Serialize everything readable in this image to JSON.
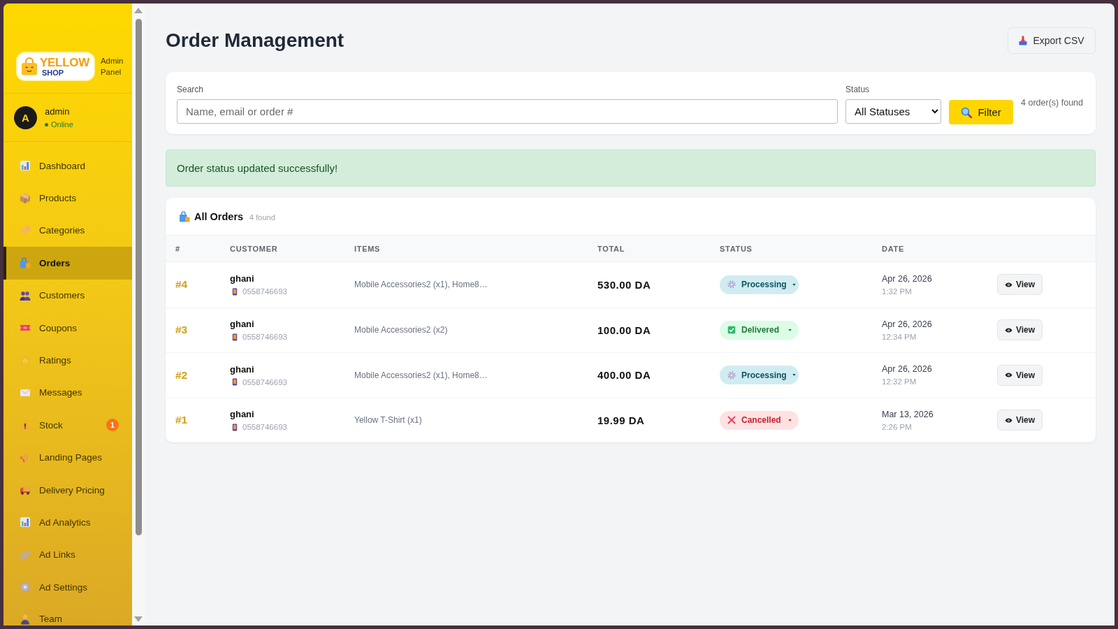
{
  "sidebar": {
    "logo": {
      "line_1": "YELLOW",
      "line_2": "SHOP"
    },
    "subtitle": "Admin Panel",
    "user": {
      "initial": "A",
      "name": "admin",
      "status": "Online"
    },
    "nav": [
      {
        "label": "Dashboard",
        "selected": false
      },
      {
        "label": "Products",
        "selected": false
      },
      {
        "label": "Categories",
        "selected": false
      },
      {
        "label": "Orders",
        "selected": true
      },
      {
        "label": "Customers",
        "selected": false
      },
      {
        "label": "Coupons",
        "selected": false
      },
      {
        "label": "Ratings",
        "selected": false
      },
      {
        "label": "Messages",
        "selected": false
      },
      {
        "label": "Stock",
        "selected": false,
        "badge": "1"
      },
      {
        "label": "Landing Pages",
        "selected": false
      },
      {
        "label": "Delivery Pricing",
        "selected": false
      },
      {
        "label": "Ad Analytics",
        "selected": false
      },
      {
        "label": "Ad Links",
        "selected": false
      },
      {
        "label": "Ad Settings",
        "selected": false
      },
      {
        "label": "Team",
        "selected": false
      }
    ]
  },
  "header": {
    "title": "Order Management",
    "export_button": "Export CSV"
  },
  "filters": {
    "search": {
      "label": "Search",
      "placeholder": "Name, email or order #"
    },
    "status_filter": {
      "label": "Status",
      "value": "All Statuses"
    },
    "filter_button": "Filter",
    "result_count": "4 order(s) found"
  },
  "alert": {
    "message": "Order status updated successfully!"
  },
  "orders": {
    "title": "All Orders",
    "count": "4 found",
    "columns": [
      "#",
      "CUSTOMER",
      "ITEMS",
      "TOTAL",
      "STATUS",
      "DATE"
    ],
    "rows": [
      {
        "number": "#4",
        "customer": "ghani",
        "phone": "0558746693",
        "items": "Mobile Accessories2 (x1), Home8…",
        "total": "530.00 DA",
        "status": {
          "kind": "processing",
          "label": "Processing"
        },
        "date": "Apr 26, 2026",
        "time": "1:32 PM",
        "action": "View"
      },
      {
        "number": "#3",
        "customer": "ghani",
        "phone": "0558746693",
        "items": "Mobile Accessories2 (x2)",
        "total": "100.00 DA",
        "status": {
          "kind": "delivered",
          "label": "Delivered"
        },
        "date": "Apr 26, 2026",
        "time": "12:34 PM",
        "action": "View"
      },
      {
        "number": "#2",
        "customer": "ghani",
        "phone": "0558746693",
        "items": "Mobile Accessories2 (x1), Home8…",
        "total": "400.00 DA",
        "status": {
          "kind": "processing",
          "label": "Processing"
        },
        "date": "Apr 26, 2026",
        "time": "12:32 PM",
        "action": "View"
      },
      {
        "number": "#1",
        "customer": "ghani",
        "phone": "0558746693",
        "items": "Yellow T-Shirt (x1)",
        "total": "19.99 DA",
        "status": {
          "kind": "cancelled",
          "label": "Cancelled"
        },
        "date": "Mar 13, 2026",
        "time": "2:26 PM",
        "action": "View"
      }
    ]
  }
}
